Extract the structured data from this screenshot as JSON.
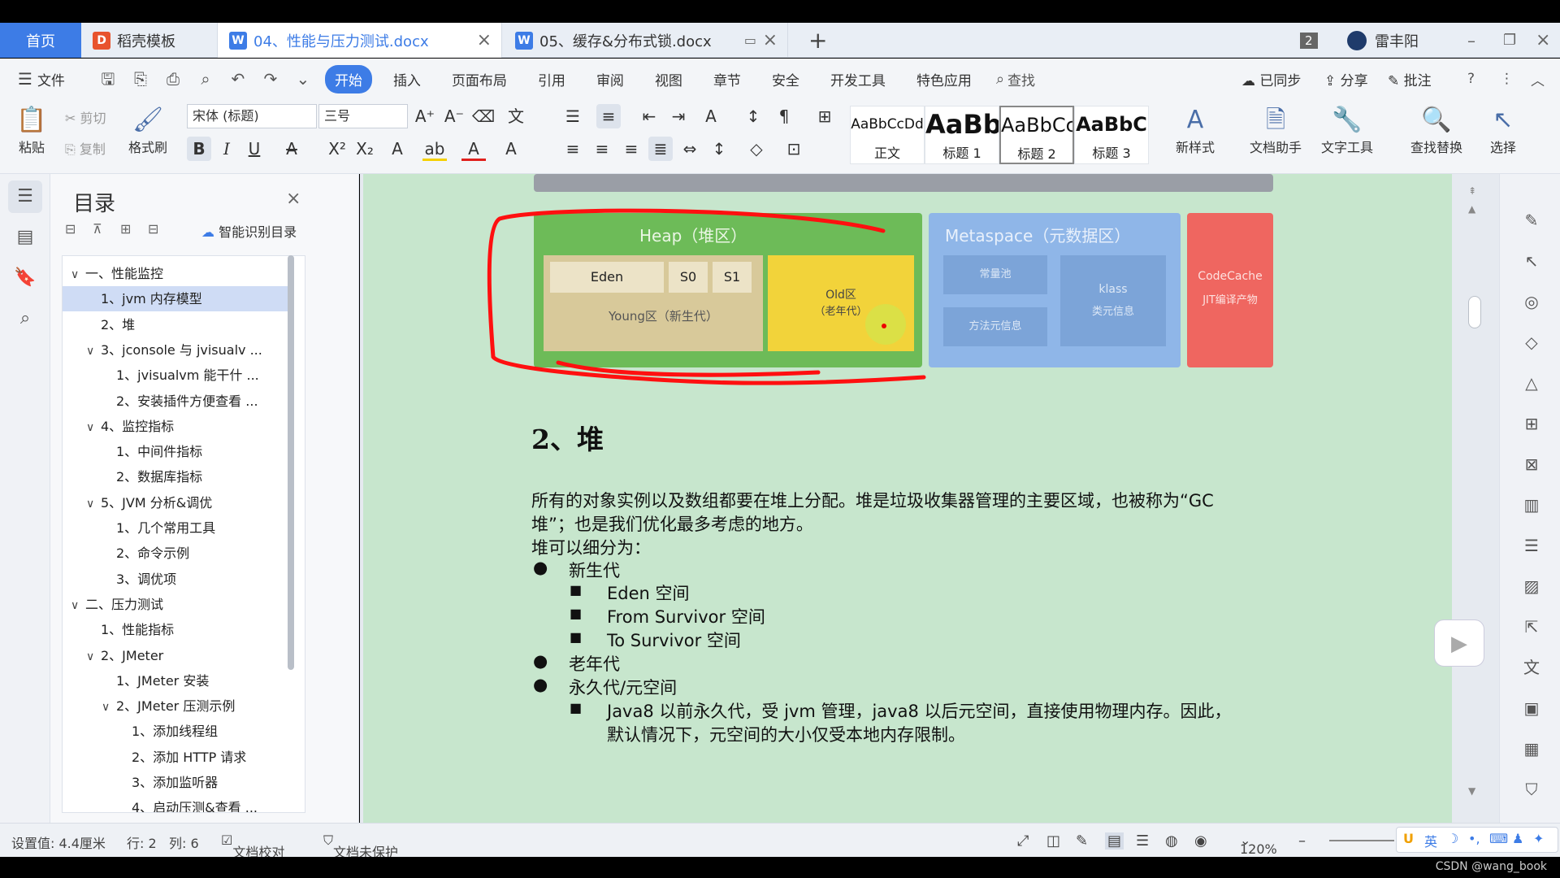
{
  "tabs": {
    "home": "首页",
    "template": "稻壳模板",
    "doc1": "04、性能与压力测试.docx",
    "doc2": "05、缓存&分布式锁.docx",
    "count_badge": "2",
    "user": "雷丰阳"
  },
  "menu": {
    "file": "文件",
    "items": [
      "开始",
      "插入",
      "页面布局",
      "引用",
      "审阅",
      "视图",
      "章节",
      "安全",
      "开发工具",
      "特色应用"
    ],
    "search": "查找",
    "synced": "已同步",
    "share": "分享",
    "comment": "批注"
  },
  "ribbon": {
    "paste": "粘贴",
    "cut": "剪切",
    "copy": "复制",
    "format_painter": "格式刷",
    "font_name": "宋体 (标题)",
    "font_size": "三号",
    "styles": [
      {
        "sample": "AaBbCcDd",
        "name": "正文"
      },
      {
        "sample": "AaBb",
        "name": "标题 1"
      },
      {
        "sample": "AaBbCc",
        "name": "标题 2"
      },
      {
        "sample": "AaBbC",
        "name": "标题 3"
      }
    ],
    "new_style": "新样式",
    "doc_assistant": "文档助手",
    "text_tools": "文字工具",
    "find_replace": "查找替换",
    "select": "选择"
  },
  "toc": {
    "title": "目录",
    "smart": "智能识别目录",
    "items": [
      {
        "label": "一、性能监控",
        "level": 0,
        "chev": "⌄"
      },
      {
        "label": "1、jvm 内存模型",
        "level": 1,
        "chev": "",
        "selected": true
      },
      {
        "label": "2、堆",
        "level": 1,
        "chev": ""
      },
      {
        "label": "3、jconsole 与 jvisualv ...",
        "level": 1,
        "chev": "⌄"
      },
      {
        "label": "1、jvisualvm 能干什 ...",
        "level": 2,
        "chev": ""
      },
      {
        "label": "2、安装插件方便查看 ...",
        "level": 2,
        "chev": ""
      },
      {
        "label": "4、监控指标",
        "level": 1,
        "chev": "⌄"
      },
      {
        "label": "1、中间件指标",
        "level": 2,
        "chev": ""
      },
      {
        "label": "2、数据库指标",
        "level": 2,
        "chev": ""
      },
      {
        "label": "5、JVM 分析&调优",
        "level": 1,
        "chev": "⌄"
      },
      {
        "label": "1、几个常用工具",
        "level": 2,
        "chev": ""
      },
      {
        "label": "2、命令示例",
        "level": 2,
        "chev": ""
      },
      {
        "label": "3、调优项",
        "level": 2,
        "chev": ""
      },
      {
        "label": "二、压力测试",
        "level": 0,
        "chev": "⌄"
      },
      {
        "label": "1、性能指标",
        "level": 1,
        "chev": ""
      },
      {
        "label": "2、JMeter",
        "level": 1,
        "chev": "⌄"
      },
      {
        "label": "1、JMeter 安装",
        "level": 2,
        "chev": ""
      },
      {
        "label": "2、JMeter 压测示例",
        "level": 2,
        "chev": "⌄"
      },
      {
        "label": "1、添加线程组",
        "level": 3,
        "chev": ""
      },
      {
        "label": "2、添加 HTTP 请求",
        "level": 3,
        "chev": ""
      },
      {
        "label": "3、添加监听器",
        "level": 3,
        "chev": ""
      },
      {
        "label": "4、启动压测&查看 ...",
        "level": 3,
        "chev": ""
      }
    ]
  },
  "diagram": {
    "heap": "Heap（堆区）",
    "eden": "Eden",
    "s0": "S0",
    "s1": "S1",
    "young": "Young区（新生代）",
    "old": "Old区",
    "old_sub": "（老年代）",
    "metaspace": "Metaspace（元数据区）",
    "const_pool": "常量池",
    "method_meta": "方法元信息",
    "klass": "klass",
    "klass_sub": "类元信息",
    "codecache": "CodeCache",
    "codecache_sub": "JIT编译产物"
  },
  "document": {
    "heading": "2、堆",
    "para1_line1": "所有的对象实例以及数组都要在堆上分配。堆是垃圾收集器管理的主要区域，也被称为“GC",
    "para1_line2": "堆”；也是我们优化最多考虑的地方。",
    "para2": "堆可以细分为：",
    "young_gen": "新生代",
    "eden_space": "Eden 空间",
    "from_space": "From Survivor 空间",
    "to_space": "To Survivor 空间",
    "old_gen": "老年代",
    "perm_gen": "永久代/元空间",
    "java8_line1": "Java8 以前永久代，受 jvm 管理，java8 以后元空间，直接使用物理内存。因此，",
    "java8_line2": "默认情况下，元空间的大小仅受本地内存限制。"
  },
  "status": {
    "setting": "设置值: 4.4厘米",
    "row": "行: 2",
    "col": "列: 6",
    "proof": "文档校对",
    "protect": "文档未保护",
    "zoom": "120%",
    "ime": "英",
    "watermark": "CSDN @wang_book"
  },
  "colors": {
    "accent": "#3d7ce6",
    "page_bg": "#c7e6cd",
    "heap_green": "#6dbb58",
    "old_yellow": "#f2d33a",
    "metaspace_blue": "#8fb6e8",
    "codecache_red": "#ef6660",
    "annotation_red": "#ff1010"
  }
}
